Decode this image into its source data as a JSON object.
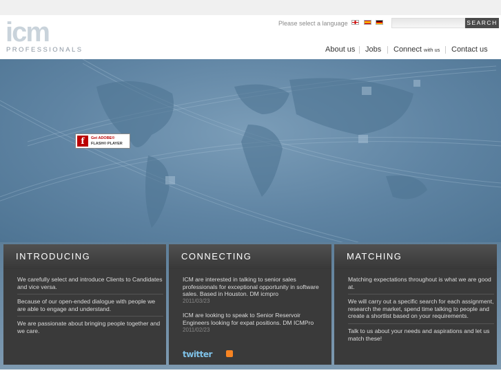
{
  "header": {
    "logo": {
      "mark": "icm",
      "sub": "PROFESSIONALS"
    },
    "language_label": "Please select a language",
    "flags": [
      "uk-flag-icon",
      "spain-flag-icon",
      "germany-flag-icon"
    ],
    "search_button": "SEARCH",
    "nav": [
      {
        "label": "About us"
      },
      {
        "label": "Jobs"
      },
      {
        "label": "Connect",
        "small": "with us"
      },
      {
        "label": "Contact us"
      }
    ]
  },
  "hero": {
    "flash_badge": {
      "line1": "Get ADOBE®",
      "line2": "FLASH® PLAYER"
    }
  },
  "panels": {
    "introducing": {
      "title": "INTRODUCING",
      "items": [
        "We carefully select and introduce Clients to Candidates and vice versa.",
        "Because of our open-ended dialogue with people we are able to engage and understand.",
        "We are passionate about bringing people together and we care."
      ]
    },
    "connecting": {
      "title": "CONNECTING",
      "items": [
        {
          "text": "ICM are interested in talking to senior sales professionals for exceptional opportunity in software sales. Based in Houston. DM icmpro",
          "date": "2011/03/23"
        },
        {
          "text": "ICM are looking to speak to Senior Reservoir Engineers looking for expat positions. DM ICMPro",
          "date": "2011/02/23"
        }
      ],
      "twitter": "twitter"
    },
    "matching": {
      "title": "MATCHING",
      "items": [
        "Matching expectations throughout is what we are good at.",
        "We will carry out a specific search for each assignment, research the market, spend time talking to people and create a shortlist based on your requirements.",
        "Talk to us about your needs and aspirations and let us match these!"
      ]
    }
  },
  "colors": {
    "hero": "#6a8eab",
    "panel": "#3a3a3a",
    "panel_head": "#505050",
    "search_button": "#4a4a4a"
  }
}
